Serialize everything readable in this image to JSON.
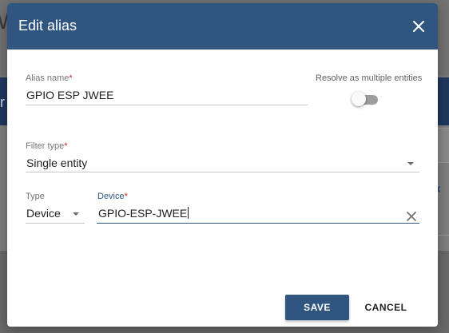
{
  "background": {
    "top_letter": "W",
    "band_letter": "r"
  },
  "dialog": {
    "title": "Edit alias",
    "close_icon": "close-icon"
  },
  "alias_name": {
    "label": "Alias name",
    "required_mark": "*",
    "value": "GPIO ESP JWEE"
  },
  "resolve_multiple": {
    "label": "Resolve as multiple entities",
    "checked": false
  },
  "filter_type": {
    "label": "Filter type",
    "required_mark": "*",
    "value": "Single entity"
  },
  "entity_type": {
    "label": "Type",
    "value": "Device"
  },
  "device": {
    "label": "Device",
    "required_mark": "*",
    "value": "GPIO-ESP-JWEE"
  },
  "actions": {
    "save": "SAVE",
    "cancel": "CANCEL"
  },
  "colors": {
    "primary": "#305680",
    "required": "#c62828"
  }
}
